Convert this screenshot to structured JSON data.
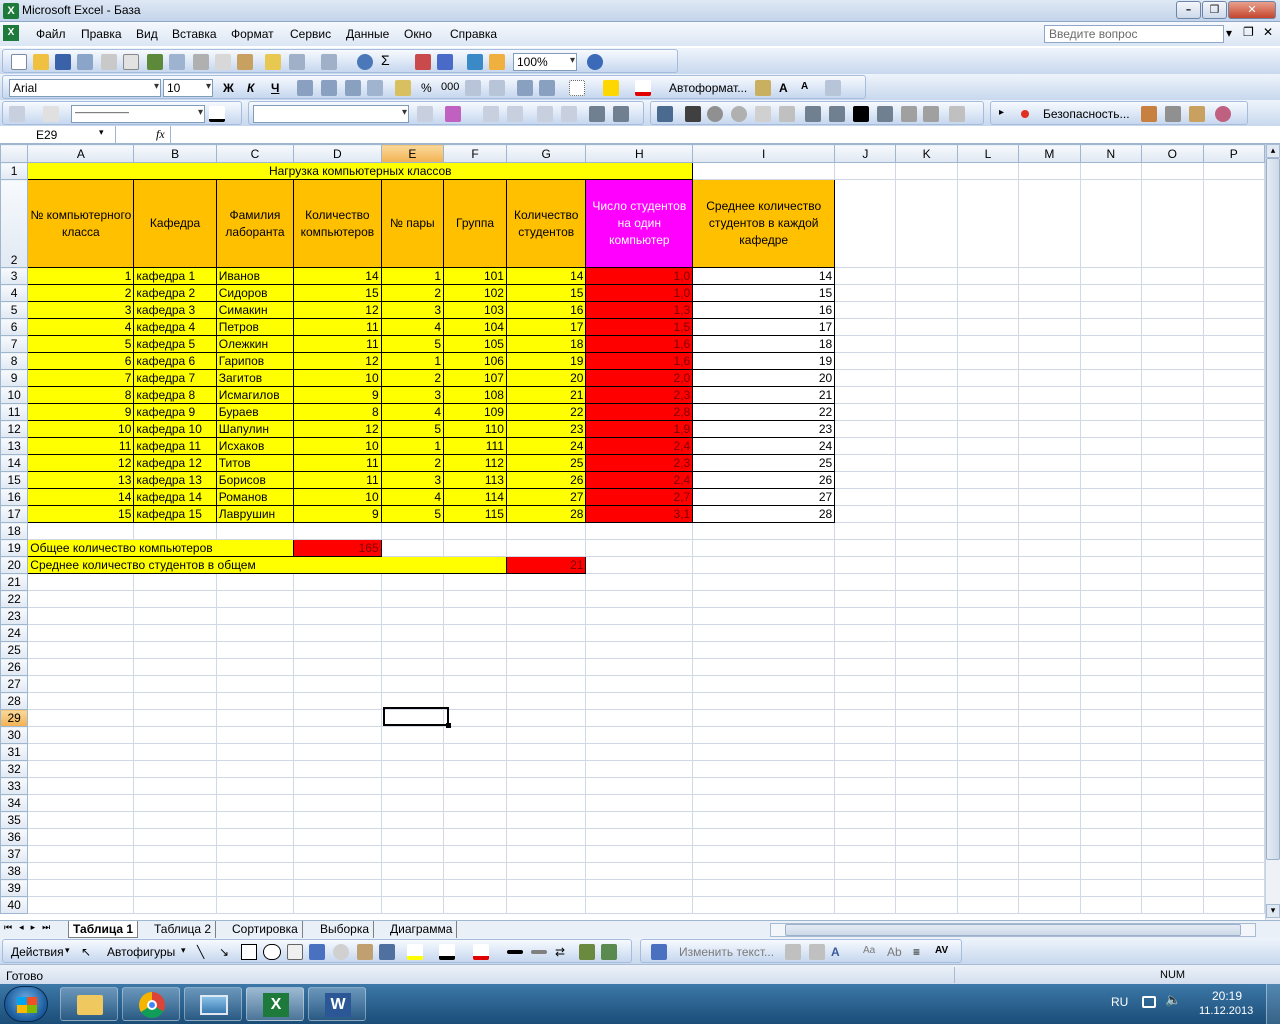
{
  "window": {
    "title": "Microsoft Excel - База",
    "help_placeholder": "Введите вопрос"
  },
  "menu": [
    "Файл",
    "Правка",
    "Вид",
    "Вставка",
    "Формат",
    "Сервис",
    "Данные",
    "Окно",
    "Справка"
  ],
  "toolbar": {
    "zoom": "100%",
    "font_name": "Arial",
    "font_size": "10",
    "bold": "Ж",
    "italic": "К",
    "underline": "Ч",
    "percent": "%",
    "thousands": "000",
    "autoformat": "Автоформат...",
    "security": "Безопасность...",
    "line_style": "——————",
    "sum_symbol": "Σ"
  },
  "formula_bar": {
    "name_box": "E29",
    "fx": "fx",
    "content": ""
  },
  "sheet": {
    "columns": [
      "A",
      "B",
      "C",
      "D",
      "E",
      "F",
      "G",
      "H",
      "I",
      "J",
      "K",
      "L",
      "M",
      "N",
      "O",
      "P"
    ],
    "selected_column": "E",
    "selected_row": "29",
    "title": "Нагрузка компьютерных классов",
    "headers": [
      "№ компьютерного класса",
      "Кафедра",
      "Фамилия лаборанта",
      "Количество компьютеров",
      "№ пары",
      "Группа",
      "Количество студентов",
      "Число студентов на один компьютер",
      "Среднее количество студентов в каждой кафедре"
    ],
    "rows": [
      [
        "1",
        "кафедра 1",
        "Иванов",
        "14",
        "1",
        "101",
        "14",
        "1,0",
        "14"
      ],
      [
        "2",
        "кафедра 2",
        "Сидоров",
        "15",
        "2",
        "102",
        "15",
        "1,0",
        "15"
      ],
      [
        "3",
        "кафедра 3",
        "Симакин",
        "12",
        "3",
        "103",
        "16",
        "1,3",
        "16"
      ],
      [
        "4",
        "кафедра 4",
        "Петров",
        "11",
        "4",
        "104",
        "17",
        "1,5",
        "17"
      ],
      [
        "5",
        "кафедра 5",
        "Олежкин",
        "11",
        "5",
        "105",
        "18",
        "1,6",
        "18"
      ],
      [
        "6",
        "кафедра 6",
        "Гарипов",
        "12",
        "1",
        "106",
        "19",
        "1,6",
        "19"
      ],
      [
        "7",
        "кафедра 7",
        "Загитов",
        "10",
        "2",
        "107",
        "20",
        "2,0",
        "20"
      ],
      [
        "8",
        "кафедра 8",
        "Исмагилов",
        "9",
        "3",
        "108",
        "21",
        "2,3",
        "21"
      ],
      [
        "9",
        "кафедра 9",
        "Бураев",
        "8",
        "4",
        "109",
        "22",
        "2,8",
        "22"
      ],
      [
        "10",
        "кафедра 10",
        "Шапулин",
        "12",
        "5",
        "110",
        "23",
        "1,9",
        "23"
      ],
      [
        "11",
        "кафедра 11",
        "Исхаков",
        "10",
        "1",
        "111",
        "24",
        "2,4",
        "24"
      ],
      [
        "12",
        "кафедра 12",
        "Титов",
        "11",
        "2",
        "112",
        "25",
        "2,3",
        "25"
      ],
      [
        "13",
        "кафедра 13",
        "Борисов",
        "11",
        "3",
        "113",
        "26",
        "2,4",
        "26"
      ],
      [
        "14",
        "кафедра 14",
        "Романов",
        "10",
        "4",
        "114",
        "27",
        "2,7",
        "27"
      ],
      [
        "15",
        "кафедра 15",
        "Лаврушин",
        "9",
        "5",
        "115",
        "28",
        "3,1",
        "28"
      ]
    ],
    "total_computers_label": "Общее количество компьютеров",
    "total_computers_value": "165",
    "avg_students_label": "Среднее количество студентов в общем",
    "avg_students_value": "21"
  },
  "sheet_tabs": [
    "Таблица 1",
    "Таблица 2",
    "Сортировка",
    "Выборка",
    "Диаграмма"
  ],
  "active_tab": "Таблица 1",
  "drawing_bar": {
    "actions": "Действия",
    "autoshapes": "Автофигуры",
    "edit_text": "Изменить текст..."
  },
  "status": {
    "left": "Готово",
    "num": "NUM"
  },
  "taskbar": {
    "lang": "RU",
    "time": "20:19",
    "date": "11.12.2013"
  },
  "colors": {
    "yellow": "#ffff00",
    "orange": "#ffc000",
    "magenta": "#ff00ff",
    "red": "#ff0000",
    "selection_header": "#f3b252"
  }
}
